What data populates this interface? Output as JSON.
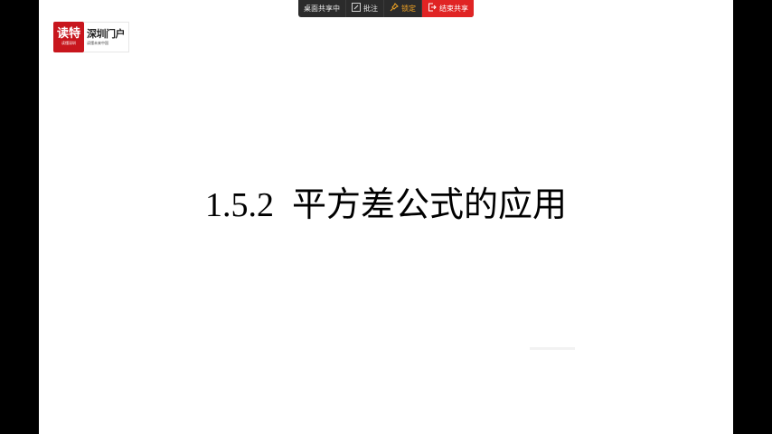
{
  "toolbar": {
    "status": "桌面共享中",
    "annotate": "批注",
    "lock": "锁定",
    "end": "结束共享",
    "icons": {
      "annotate": "pencil-icon",
      "lock": "pin-icon",
      "end": "exit-icon"
    },
    "colors": {
      "bar": "#2b2b2b",
      "lock": "#f5a623",
      "end": "#e02424"
    }
  },
  "logo": {
    "brand_main": "读特",
    "brand_sub": "读懂深圳",
    "portal_main": "深圳门户",
    "portal_sub": "读懂未来中国",
    "colors": {
      "brand": "#c8161d"
    }
  },
  "slide": {
    "title_number": "1.5.2",
    "title_text": "平方差公式的应用"
  }
}
